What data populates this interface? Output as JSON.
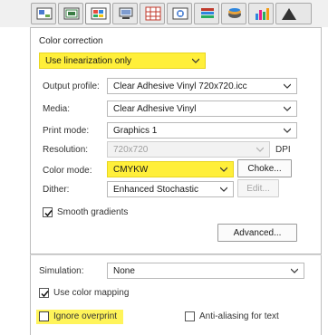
{
  "toolbar": {
    "tabs": [
      {
        "icon": "layout-icon"
      },
      {
        "icon": "media-icon"
      },
      {
        "icon": "color-settings-icon"
      },
      {
        "icon": "print-queue-icon"
      },
      {
        "icon": "grid-icon"
      },
      {
        "icon": "image-icon"
      },
      {
        "icon": "list-icon"
      },
      {
        "icon": "ink-icon"
      },
      {
        "icon": "bar-chart-icon"
      },
      {
        "icon": "triangle-icon"
      }
    ]
  },
  "color_correction": {
    "title": "Color correction",
    "mode_value": "Use linearization only"
  },
  "fields": {
    "output_profile": {
      "label": "Output profile:",
      "value": "Clear Adhesive Vinyl 720x720.icc"
    },
    "media": {
      "label": "Media:",
      "value": "Clear Adhesive Vinyl"
    },
    "print_mode": {
      "label": "Print mode:",
      "value": "Graphics 1"
    },
    "resolution": {
      "label": "Resolution:",
      "value": "720x720",
      "unit": "DPI"
    },
    "color_mode": {
      "label": "Color mode:",
      "value": "CMYKW"
    },
    "dither": {
      "label": "Dither:",
      "value": "Enhanced Stochastic"
    }
  },
  "buttons": {
    "choke": "Choke...",
    "edit": "Edit...",
    "advanced": "Advanced..."
  },
  "checkboxes": {
    "smooth_gradients": {
      "label": "Smooth gradients",
      "checked": true
    },
    "use_color_mapping": {
      "label": "Use color mapping",
      "checked": true
    },
    "ignore_overprint": {
      "label": "Ignore overprint",
      "checked": false
    },
    "anti_aliasing": {
      "label": "Anti-aliasing for text",
      "checked": false
    }
  },
  "simulation": {
    "label": "Simulation:",
    "value": "None"
  },
  "colors": {
    "highlight": "#ffef3a"
  }
}
